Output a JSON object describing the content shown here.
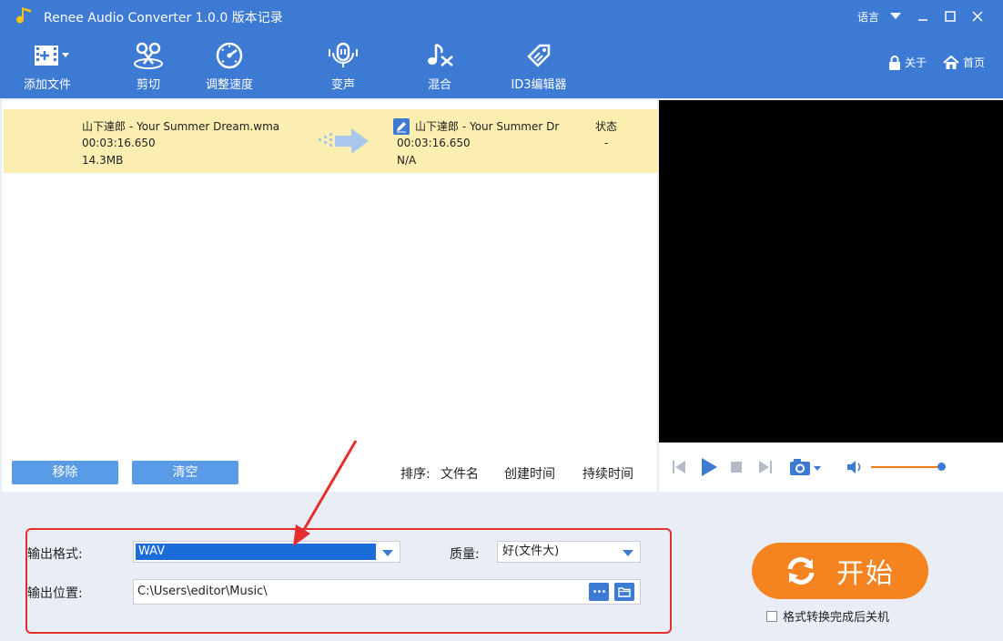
{
  "window": {
    "title": "Renee Audio Converter 1.0.0 版本记录",
    "language_label": "语言"
  },
  "toolbar": {
    "add_file": "添加文件",
    "cut": "剪切",
    "speed": "调整速度",
    "voice": "变声",
    "mix": "混合",
    "id3": "ID3编辑器",
    "about": "关于",
    "home": "首页"
  },
  "file": {
    "source_name": "山下達郎 - Your Summer Dream.wma",
    "source_duration": "00:03:16.650",
    "source_size": "14.3MB",
    "target_name": "山下達郎 - Your Summer Dr",
    "target_duration": "00:03:16.650",
    "target_size": "N/A",
    "status_header": "状态",
    "status_value": "-"
  },
  "list_actions": {
    "remove": "移除",
    "clear": "清空",
    "sort_label": "排序:",
    "sort_name": "文件名",
    "sort_created": "创建时间",
    "sort_duration": "持续时间"
  },
  "player": {
    "volume_level": 0.9
  },
  "output": {
    "format_label": "输出格式:",
    "format_value": "WAV",
    "quality_label": "质量:",
    "quality_value": "好(文件大)",
    "location_label": "输出位置:",
    "location_value": "C:\\Users\\editor\\Music\\",
    "browse_label": "•••"
  },
  "start": {
    "label": "开始",
    "shutdown_label": "格式转换完成后关机"
  },
  "colors": {
    "brand_blue": "#3d7ad4",
    "start_orange": "#f5831f",
    "highlight_row": "#fbeeb0",
    "annotation_red": "#e52f2f"
  }
}
